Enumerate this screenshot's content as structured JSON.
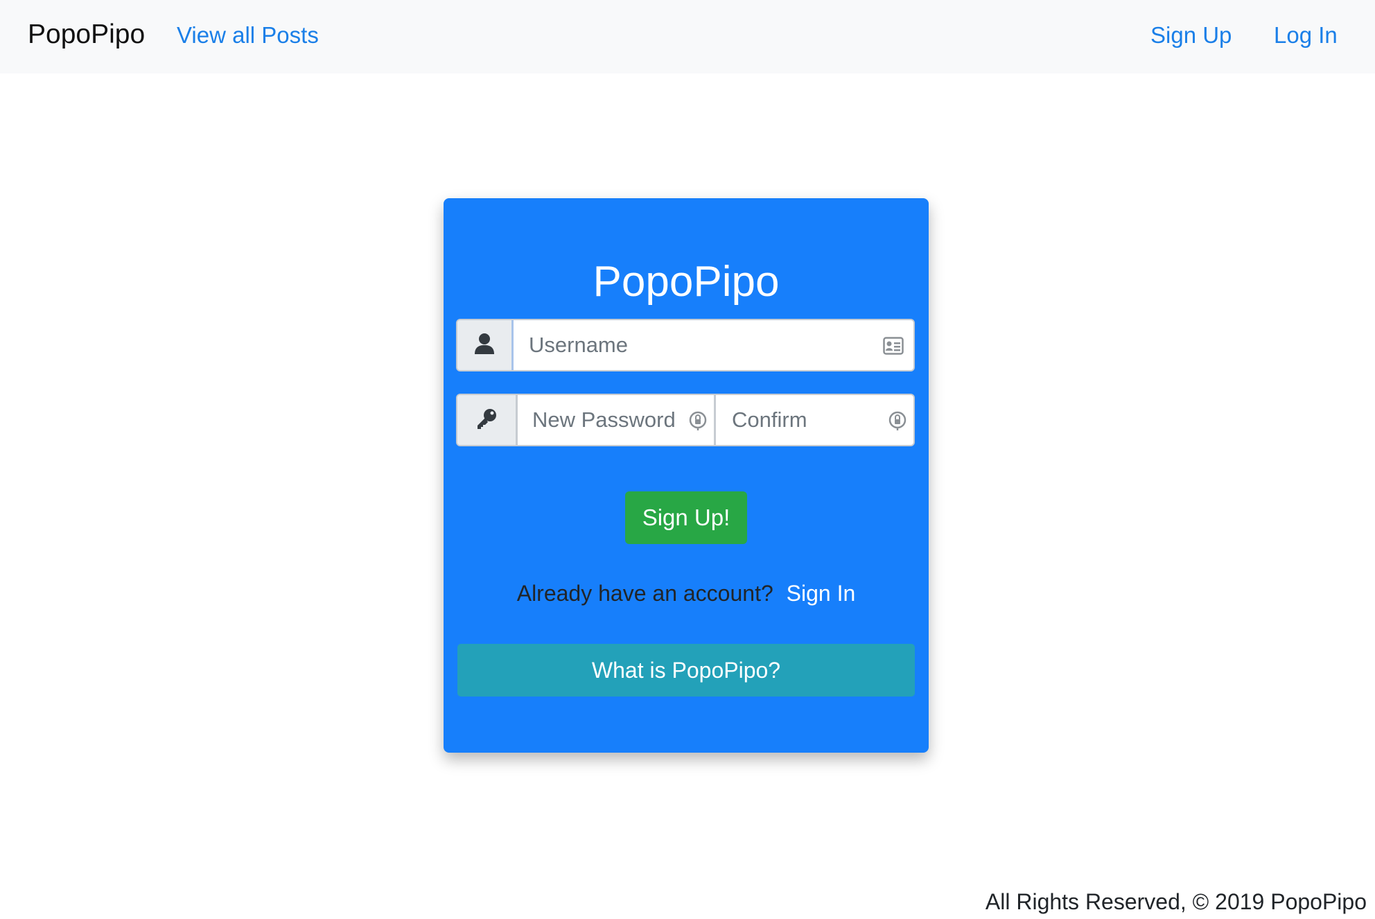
{
  "navbar": {
    "brand": "PopoPipo",
    "view_posts": "View all Posts",
    "sign_up": "Sign Up",
    "log_in": "Log In"
  },
  "card": {
    "title": "PopoPipo",
    "username_placeholder": "Username",
    "new_password_placeholder": "New Password",
    "confirm_placeholder": "Confirm",
    "signup_button": "Sign Up!",
    "already_text": "Already have an account?",
    "signin_link": "Sign In",
    "what_button": "What is PopoPipo?"
  },
  "footer": {
    "text": "All Rights Reserved, © 2019 PopoPipo"
  },
  "colors": {
    "card_bg": "#177ffb",
    "link": "#1a7fe8",
    "success": "#28a745",
    "info": "#23a1b9"
  },
  "icons": {
    "user_addon": "user-icon",
    "password_addon": "key-icon",
    "username_trailing": "contact-card-icon",
    "password_trailing": "password-manager-icon"
  }
}
